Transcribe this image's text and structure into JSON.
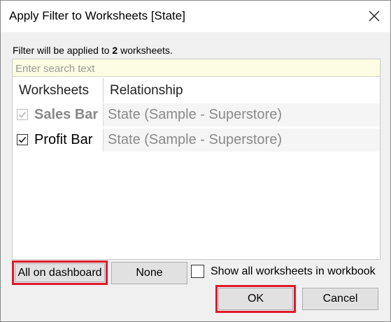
{
  "dialog": {
    "title": "Apply Filter to Worksheets [State]"
  },
  "info": {
    "prefix": "Filter will be applied to ",
    "count": "2",
    "suffix": " worksheets."
  },
  "search": {
    "placeholder": "Enter search text"
  },
  "table": {
    "headers": {
      "worksheets": "Worksheets",
      "relationship": "Relationship"
    },
    "rows": [
      {
        "name": "Sales Bar",
        "relationship": "State (Sample - Superstore)",
        "checked": true,
        "disabled": true
      },
      {
        "name": "Profit Bar",
        "relationship": "State (Sample - Superstore)",
        "checked": true,
        "disabled": false
      }
    ]
  },
  "buttons": {
    "all_on_dashboard": "All on dashboard",
    "none": "None",
    "ok": "OK",
    "cancel": "Cancel"
  },
  "show_all": {
    "label": "Show all worksheets in workbook",
    "checked": false
  },
  "colors": {
    "highlight": "#e0192a",
    "search_bg": "#fdfde3",
    "dialog_bg": "#f0f0f0"
  }
}
